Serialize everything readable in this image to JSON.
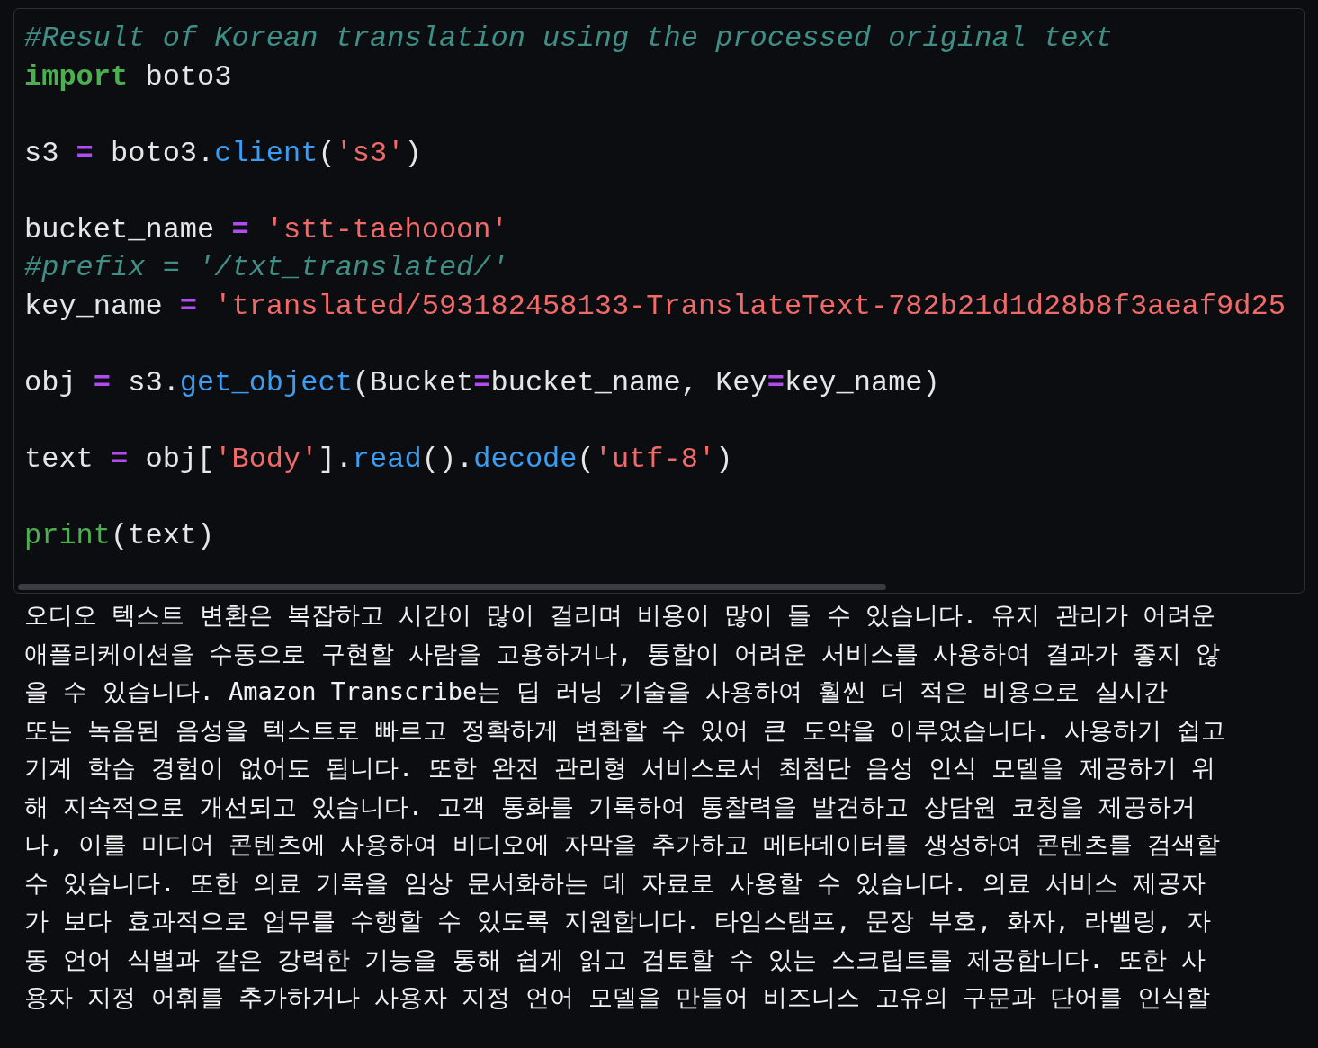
{
  "code_cell": {
    "lines": [
      {
        "kind": "code",
        "tokens": [
          {
            "kind": "comment",
            "text": "#Result of Korean translation using the processed original text"
          }
        ]
      },
      {
        "kind": "code",
        "tokens": [
          {
            "kind": "keyword",
            "text": "import"
          },
          {
            "kind": "plain",
            "text": " boto3"
          }
        ]
      },
      {
        "kind": "blank"
      },
      {
        "kind": "code",
        "tokens": [
          {
            "kind": "plain",
            "text": "s3 "
          },
          {
            "kind": "op",
            "text": "="
          },
          {
            "kind": "plain",
            "text": " boto3."
          },
          {
            "kind": "func",
            "text": "client"
          },
          {
            "kind": "plain",
            "text": "("
          },
          {
            "kind": "string",
            "text": "'s3'"
          },
          {
            "kind": "plain",
            "text": ")"
          }
        ]
      },
      {
        "kind": "blank"
      },
      {
        "kind": "code",
        "tokens": [
          {
            "kind": "plain",
            "text": "bucket_name "
          },
          {
            "kind": "op",
            "text": "="
          },
          {
            "kind": "string",
            "text": " 'stt-taehooon'"
          }
        ]
      },
      {
        "kind": "code",
        "tokens": [
          {
            "kind": "comment",
            "text": "#prefix = '/txt_translated/'"
          }
        ]
      },
      {
        "kind": "code",
        "tokens": [
          {
            "kind": "plain",
            "text": "key_name "
          },
          {
            "kind": "op",
            "text": "="
          },
          {
            "kind": "string",
            "text": " 'translated/593182458133-TranslateText-782b21d1d28b8f3aeaf9d25"
          }
        ]
      },
      {
        "kind": "blank"
      },
      {
        "kind": "code",
        "tokens": [
          {
            "kind": "plain",
            "text": "obj "
          },
          {
            "kind": "op",
            "text": "="
          },
          {
            "kind": "plain",
            "text": " s3."
          },
          {
            "kind": "func",
            "text": "get_object"
          },
          {
            "kind": "plain",
            "text": "(Bucket"
          },
          {
            "kind": "op",
            "text": "="
          },
          {
            "kind": "plain",
            "text": "bucket_name, Key"
          },
          {
            "kind": "op",
            "text": "="
          },
          {
            "kind": "plain",
            "text": "key_name)"
          }
        ]
      },
      {
        "kind": "blank"
      },
      {
        "kind": "code",
        "tokens": [
          {
            "kind": "plain",
            "text": "text "
          },
          {
            "kind": "op",
            "text": "="
          },
          {
            "kind": "plain",
            "text": " obj["
          },
          {
            "kind": "string",
            "text": "'Body'"
          },
          {
            "kind": "plain",
            "text": "]."
          },
          {
            "kind": "func",
            "text": "read"
          },
          {
            "kind": "plain",
            "text": "()."
          },
          {
            "kind": "func",
            "text": "decode"
          },
          {
            "kind": "plain",
            "text": "("
          },
          {
            "kind": "string",
            "text": "'utf-8'"
          },
          {
            "kind": "plain",
            "text": ")"
          }
        ]
      },
      {
        "kind": "blank"
      },
      {
        "kind": "code",
        "tokens": [
          {
            "kind": "builtin",
            "text": "print"
          },
          {
            "kind": "plain",
            "text": "(text)"
          }
        ]
      }
    ]
  },
  "output_lines": [
    "오디오 텍스트 변환은 복잡하고 시간이 많이 걸리며 비용이 많이 들 수 있습니다. 유지 관리가 어려운",
    "애플리케이션을 수동으로 구현할 사람을 고용하거나, 통합이 어려운 서비스를 사용하여 결과가 좋지 않",
    "을 수 있습니다. Amazon Transcribe는 딥 러닝 기술을 사용하여 훨씬 더 적은 비용으로 실시간",
    "또는 녹음된 음성을 텍스트로 빠르고 정확하게 변환할 수 있어 큰 도약을 이루었습니다. 사용하기 쉽고",
    "기계 학습 경험이 없어도 됩니다. 또한 완전 관리형 서비스로서 최첨단 음성 인식 모델을 제공하기 위",
    "해 지속적으로 개선되고 있습니다. 고객 통화를 기록하여 통찰력을 발견하고 상담원 코칭을 제공하거",
    "나, 이를 미디어 콘텐츠에 사용하여 비디오에 자막을 추가하고 메타데이터를 생성하여 콘텐츠를 검색할",
    "수 있습니다. 또한 의료 기록을 임상 문서화하는 데 자료로 사용할 수 있습니다. 의료 서비스 제공자",
    "가 보다 효과적으로 업무를 수행할 수 있도록 지원합니다. 타임스탬프, 문장 부호, 화자, 라벨링, 자",
    "동 언어 식별과 같은 강력한 기능을 통해 쉽게 읽고 검토할 수 있는 스크립트를 제공합니다. 또한 사",
    "용자 지정 어휘를 추가하거나 사용자 지정 언어 모델을 만들어 비즈니스 고유의 구문과 단어를 인식할"
  ]
}
